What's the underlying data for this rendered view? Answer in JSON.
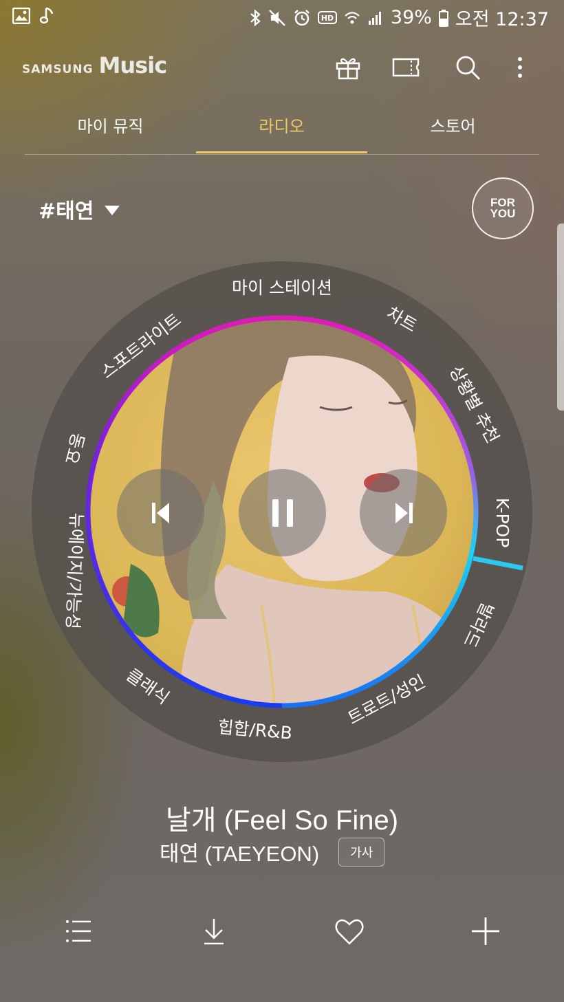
{
  "status_bar": {
    "battery": "39%",
    "time": "오전 12:37",
    "icons": [
      "gallery-icon",
      "music-note-icon",
      "bluetooth-icon",
      "mute-icon",
      "alarm-icon",
      "hd-voice-icon",
      "wifi-icon",
      "signal-icon",
      "battery-icon"
    ]
  },
  "header": {
    "brand_samsung": "SAMSUNG",
    "brand_music": "Music",
    "actions": [
      "gift-icon",
      "ticket-icon",
      "search-icon",
      "more-icon"
    ]
  },
  "tabs": [
    {
      "label": "마이 뮤직",
      "active": false
    },
    {
      "label": "라디오",
      "active": true
    },
    {
      "label": "스토어",
      "active": false
    }
  ],
  "station": {
    "name": "#태연",
    "for_you_line1": "FOR",
    "for_you_line2": "YOU"
  },
  "dial": {
    "genres": [
      "마이 스테이션",
      "차트",
      "상황별 추천",
      "K-POP",
      "발라드",
      "트로트/성인",
      "힙합/R&B",
      "클래식",
      "뉴에이지/가능성",
      "동요",
      "스포트라이트"
    ],
    "selected_genre": "K-POP",
    "ring_colors": {
      "magenta": "#e01ab8",
      "violet": "#7a1fe0",
      "blue": "#1a3cf0",
      "cyan": "#19d2f5",
      "indicator": "#2bc8f0"
    }
  },
  "track": {
    "title": "날개 (Feel So Fine)",
    "artist": "태연 (TAEYEON)",
    "lyrics_label": "가사"
  },
  "bottom_bar": [
    "list-icon",
    "download-icon",
    "heart-icon",
    "add-icon"
  ]
}
